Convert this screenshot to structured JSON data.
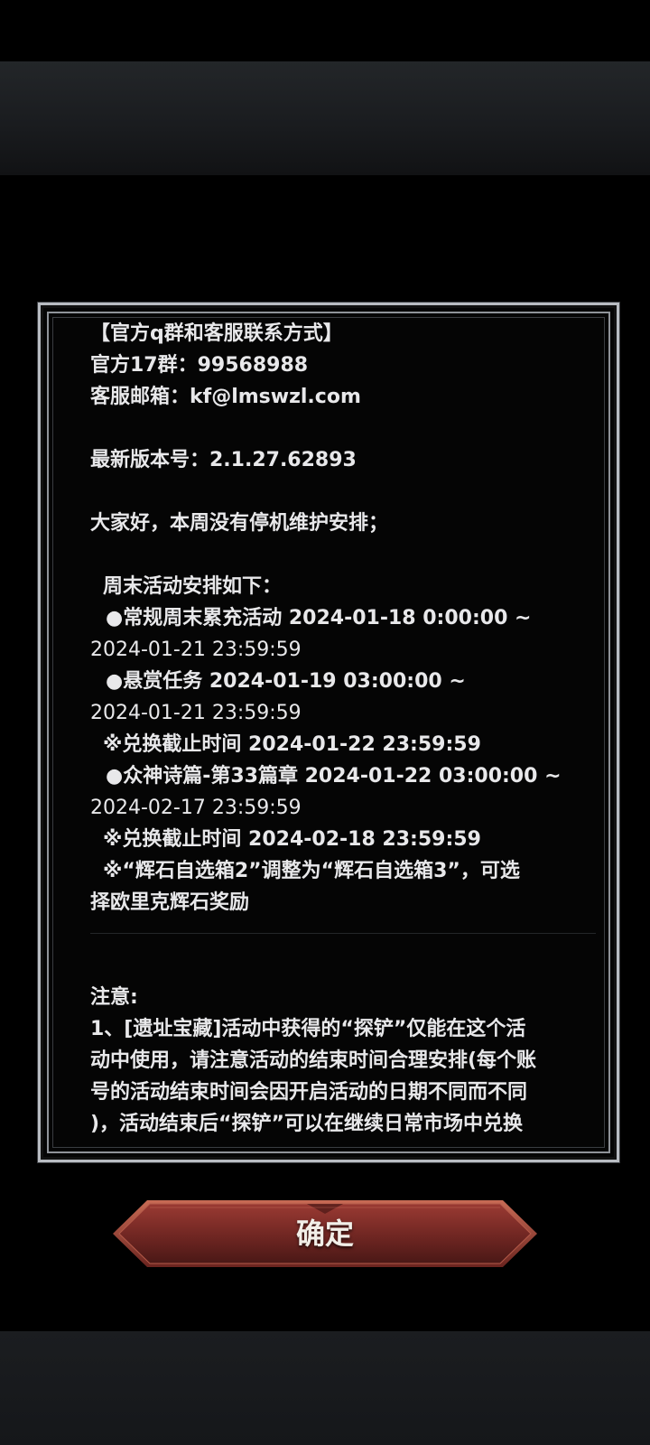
{
  "notice": {
    "lines": [
      "【官方q群和客服联系方式】",
      "官方17群：99568988",
      "客服邮箱：kf@lmswzl.com",
      "",
      "最新版本号：2.1.27.62893",
      "",
      "大家好，本周没有停机维护安排；",
      "",
      "周末活动安排如下：",
      "●常规周末累充活动 2024-01-18 0:00:00 ~",
      "2024-01-21 23:59:59",
      "●悬赏任务 2024-01-19 03:00:00 ~",
      "2024-01-21 23:59:59",
      "※兑换截止时间 2024-01-22 23:59:59",
      "●众神诗篇-第33篇章 2024-01-22 03:00:00 ~",
      "2024-02-17 23:59:59",
      "※兑换截止时间 2024-02-18 23:59:59",
      "※“辉石自选箱2”调整为“辉石自选箱3”，可选",
      "择欧里克辉石奖励"
    ],
    "note_title": "注意:",
    "note_lines": [
      "1、[遗址宝藏]活动中获得的“探铲”仅能在这个活",
      "动中使用，请注意活动的结束时间合理安排(每个账",
      "号的活动结束时间会因开启活动的日期不同而不同",
      ")，活动结束后“探铲”可以在继续日常市场中兑换"
    ]
  },
  "buttons": {
    "confirm_label": "确定"
  },
  "colors": {
    "text": "#e8e8ea",
    "frame": "#b8bcc2",
    "button_fill": "#7a2c28"
  }
}
